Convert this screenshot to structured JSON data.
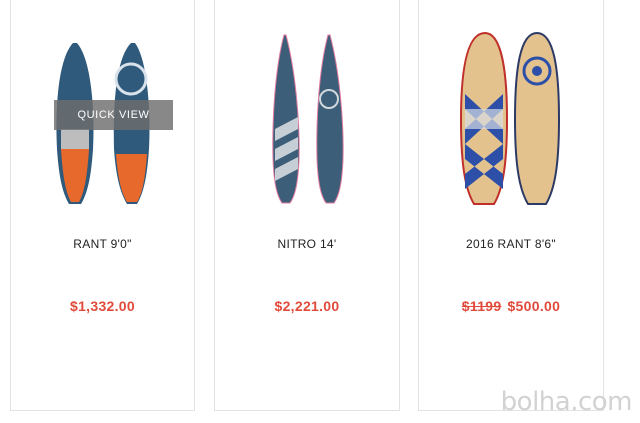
{
  "products": [
    {
      "name": "RANT 9'0\"",
      "price": "$1,332.00",
      "old_price": "",
      "quick_view": "QUICK VIEW"
    },
    {
      "name": "NITRO 14'",
      "price": "$2,221.00",
      "old_price": ""
    },
    {
      "name": "2016 RANT 8'6\"",
      "price": "$500.00",
      "old_price": "$1199"
    }
  ],
  "watermark": "bolha.com",
  "colors": {
    "price": "#e04a3b",
    "board_blue": "#2f5a7c",
    "board_orange": "#e8692c",
    "board_wood": "#e3c28e"
  }
}
